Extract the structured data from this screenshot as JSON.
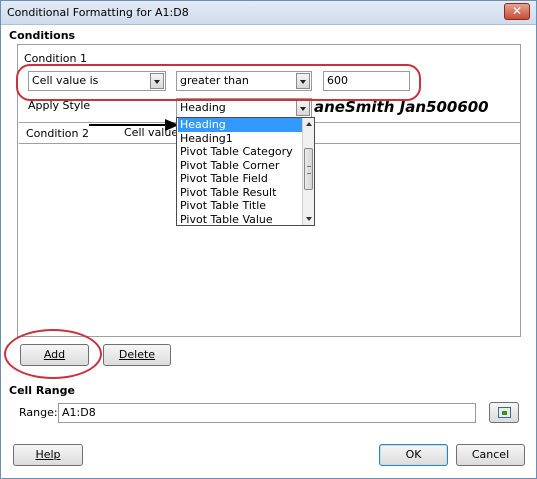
{
  "window": {
    "title": "Conditional Formatting for A1:D8",
    "close_symbol": "✕"
  },
  "conditions": {
    "section_label": "Conditions",
    "condition1": {
      "label": "Condition 1",
      "type_value": "Cell value is",
      "operator_value": "greater than",
      "value": "600",
      "apply_style_label": "Apply Style",
      "style_value": "Heading",
      "preview_text": "aneSmith Jan500600"
    },
    "condition2": {
      "label": "Condition 2",
      "type_value": "Cell value is"
    },
    "style_dropdown": {
      "items": [
        "Heading",
        "Heading1",
        "Pivot Table Category",
        "Pivot Table Corner",
        "Pivot Table Field",
        "Pivot Table Result",
        "Pivot Table Title",
        "Pivot Table Value"
      ],
      "selected": "Heading"
    }
  },
  "buttons": {
    "add": "Add",
    "delete": "Delete",
    "help": "Help",
    "ok": "OK",
    "cancel": "Cancel"
  },
  "cell_range": {
    "section_label": "Cell Range",
    "range_label": "Range:",
    "range_value": "A1:D8"
  },
  "colors": {
    "highlight_annotation": "#c8323c",
    "selection": "#3399ff",
    "title_bar": "#d6e3f1"
  }
}
